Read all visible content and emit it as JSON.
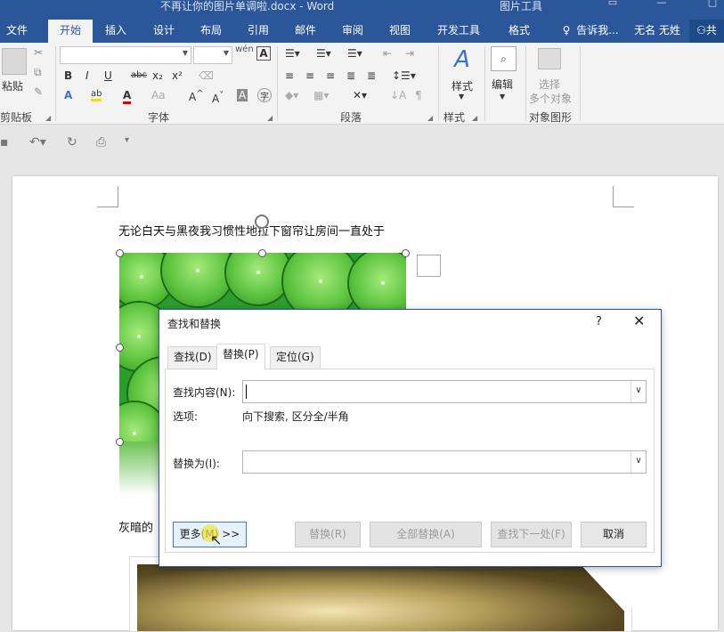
{
  "window": {
    "title": "不再让你的图片单调啦.docx - Word",
    "context_title": "图片工具"
  },
  "tabs": [
    "文件",
    "开始",
    "插入",
    "设计",
    "布局",
    "引用",
    "邮件",
    "审阅",
    "视图",
    "开发工具",
    "格式"
  ],
  "tell_me": "告诉我...",
  "user": "无名 无姓",
  "share": "共",
  "ribbon": {
    "paste": "粘贴",
    "clipboard": "剪贴板",
    "font": "字体",
    "paragraph": "段落",
    "styles_btn": "样式",
    "styles": "样式",
    "editing": "编辑",
    "select_objects": [
      "选择",
      "多个对象"
    ],
    "object_shapes": "对象图形",
    "font_tools": [
      "B",
      "I",
      "U",
      "abc",
      "x₂",
      "x²"
    ],
    "wen": "wén",
    "A": "A"
  },
  "document": {
    "line1": "无论白天与黑夜我习惯性地拉下窗帘让房间一直处于",
    "line2_prefix": "灰暗的"
  },
  "dialog": {
    "title": "查找和替换",
    "help": "?",
    "close": "✕",
    "tabs": [
      "查找(D)",
      "替换(P)",
      "定位(G)"
    ],
    "find_label": "查找内容(N):",
    "options_label": "选项:",
    "options_value": "向下搜索, 区分全/半角",
    "replace_label": "替换为(I):",
    "buttons": {
      "more": "更多(M) >>",
      "replace": "替换(R)",
      "replace_all": "全部替换(A)",
      "find_next": "查找下一处(F)",
      "cancel": "取消"
    }
  }
}
